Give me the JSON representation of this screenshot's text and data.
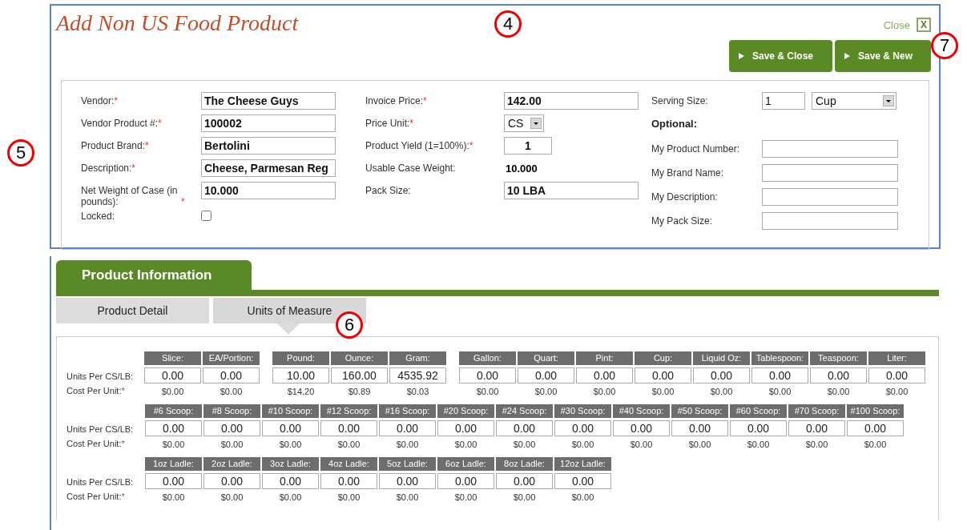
{
  "dialog": {
    "title": "Add Non US Food Product",
    "close_label": "Close",
    "close_key": "X",
    "buttons": [
      {
        "label": "Save & Close"
      },
      {
        "label": "Save & New"
      }
    ],
    "columns": [
      {
        "fields": [
          {
            "kind": "text",
            "label": "Vendor:",
            "marker": "*",
            "value": "The Cheese Guys"
          },
          {
            "kind": "text",
            "label": "Vendor Product #:",
            "marker": "*",
            "value": "100002"
          },
          {
            "kind": "text",
            "label": "Product Brand:",
            "marker": "*",
            "value": "Bertolini"
          },
          {
            "kind": "text",
            "label": "Description:",
            "marker": "*",
            "value": "Cheese, Parmesan Reg"
          },
          {
            "kind": "text",
            "label": "Net Weight of Case (in pounds):",
            "marker": "*",
            "value": "10.000"
          },
          {
            "kind": "checkbox",
            "label": "Locked:",
            "checked": false
          }
        ]
      },
      {
        "fields": [
          {
            "kind": "text",
            "label": "Invoice Price:",
            "marker": "*",
            "value": "142.00"
          },
          {
            "kind": "select",
            "label": "Price Unit:",
            "marker": "*",
            "value": "CS"
          },
          {
            "kind": "short",
            "label": "Product Yield (1=100%):",
            "marker": "*",
            "value": "1"
          },
          {
            "kind": "static",
            "label": "Usable Case Weight:",
            "value": "10.000"
          },
          {
            "kind": "text",
            "label": "Pack Size:",
            "value": "10 LBA"
          }
        ]
      },
      {
        "fields": [
          {
            "kind": "serving",
            "label": "Serving Size:",
            "value": "1",
            "unit": "Cup"
          },
          {
            "kind": "heading",
            "label": "Optional:"
          },
          {
            "kind": "text",
            "label": "My Product Number:"
          },
          {
            "kind": "text",
            "label": "My Brand Name:"
          },
          {
            "kind": "text",
            "label": "My Description:"
          },
          {
            "kind": "text",
            "label": "My Pack Size:"
          }
        ]
      }
    ]
  },
  "panel": {
    "title": "Product Information",
    "tabs": [
      {
        "label": "Product Detail",
        "selected": false
      },
      {
        "label": "Units of Measure",
        "selected": true
      }
    ],
    "unit_rows": [
      {
        "units_label": "Units Per CS/LB:",
        "cost_label": "Cost Per Unit:",
        "cost_marker": "*",
        "groups": [
          [
            {
              "name": "Slice:",
              "units": "0.00",
              "cost": "$0.00"
            },
            {
              "name": "EA/Portion:",
              "units": "0.00",
              "cost": "$0.00"
            }
          ],
          [
            {
              "name": "Pound:",
              "units": "10.00",
              "cost": "$14.20"
            },
            {
              "name": "Ounce:",
              "units": "160.00",
              "cost": "$0.89"
            },
            {
              "name": "Gram:",
              "units": "4535.92",
              "cost": "$0.03"
            }
          ],
          [
            {
              "name": "Gallon:",
              "units": "0.00",
              "cost": "$0.00"
            },
            {
              "name": "Quart:",
              "units": "0.00",
              "cost": "$0.00"
            },
            {
              "name": "Pint:",
              "units": "0.00",
              "cost": "$0.00"
            },
            {
              "name": "Cup:",
              "units": "0.00",
              "cost": "$0.00"
            },
            {
              "name": "Liquid Oz:",
              "units": "0.00",
              "cost": "$0.00"
            },
            {
              "name": "Tablespoon:",
              "units": "0.00",
              "cost": "$0.00"
            },
            {
              "name": "Teaspoon:",
              "units": "0.00",
              "cost": "$0.00"
            },
            {
              "name": "Liter:",
              "units": "0.00",
              "cost": "$0.00"
            }
          ]
        ]
      },
      {
        "units_label": "Units Per CS/LB:",
        "cost_label": "Cost Per Unit:",
        "cost_marker": "*",
        "groups": [
          [
            {
              "name": "#6 Scoop:",
              "units": "0.00",
              "cost": "$0.00"
            },
            {
              "name": "#8 Scoop:",
              "units": "0.00",
              "cost": "$0.00"
            },
            {
              "name": "#10 Scoop:",
              "units": "0.00",
              "cost": "$0.00"
            },
            {
              "name": "#12 Scoop:",
              "units": "0.00",
              "cost": "$0.00"
            },
            {
              "name": "#16 Scoop:",
              "units": "0.00",
              "cost": "$0.00"
            },
            {
              "name": "#20 Scoop:",
              "units": "0.00",
              "cost": "$0.00"
            },
            {
              "name": "#24 Scoop:",
              "units": "0.00",
              "cost": "$0.00"
            },
            {
              "name": "#30 Scoop:",
              "units": "0.00",
              "cost": "$0.00"
            },
            {
              "name": "#40 Scoop:",
              "units": "0.00",
              "cost": "$0.00"
            },
            {
              "name": "#50 Scoop:",
              "units": "0.00",
              "cost": "$0.00"
            },
            {
              "name": "#60 Scoop:",
              "units": "0.00",
              "cost": "$0.00"
            },
            {
              "name": "#70 Scoop:",
              "units": "0.00",
              "cost": "$0.00"
            },
            {
              "name": "#100 Scoop:",
              "units": "0.00",
              "cost": "$0.00"
            }
          ]
        ]
      },
      {
        "units_label": "Units Per CS/LB:",
        "cost_label": "Cost Per Unit:",
        "cost_marker": "*",
        "groups": [
          [
            {
              "name": "1oz Ladle:",
              "units": "0.00",
              "cost": "$0.00"
            },
            {
              "name": "2oz Ladle:",
              "units": "0.00",
              "cost": "$0.00"
            },
            {
              "name": "3oz Ladle:",
              "units": "0.00",
              "cost": "$0.00"
            },
            {
              "name": "4oz Ladle:",
              "units": "0.00",
              "cost": "$0.00"
            },
            {
              "name": "5oz Ladle:",
              "units": "0.00",
              "cost": "$0.00"
            },
            {
              "name": "6oz Ladle:",
              "units": "0.00",
              "cost": "$0.00"
            },
            {
              "name": "8oz Ladle:",
              "units": "0.00",
              "cost": "$0.00"
            },
            {
              "name": "12oz Ladle:",
              "units": "0.00",
              "cost": "$0.00"
            }
          ]
        ]
      }
    ]
  },
  "callouts": [
    "4",
    "5",
    "6",
    "7"
  ]
}
